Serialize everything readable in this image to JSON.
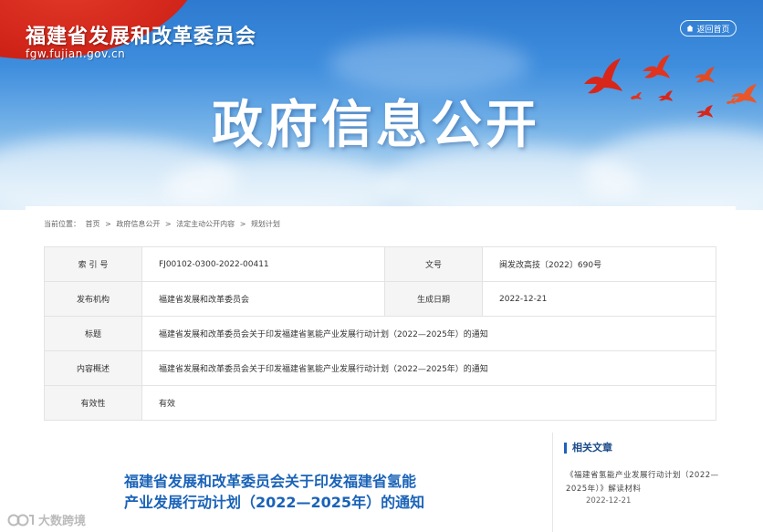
{
  "header": {
    "site_name": "福建省发展和改革委员会",
    "site_domain": "fgw.fujian.gov.cn",
    "return_home": "返回首页",
    "banner_title": "政府信息公开"
  },
  "breadcrumb": {
    "prefix": "当前位置：",
    "items": [
      "首页",
      "政府信息公开",
      "法定主动公开内容",
      "规划计划"
    ],
    "separator": ">"
  },
  "info_table": {
    "index_no_label": "索 引 号",
    "index_no_value": "FJ00102-0300-2022-00411",
    "doc_no_label": "文号",
    "doc_no_value": "闽发改高技〔2022〕690号",
    "publisher_label": "发布机构",
    "publisher_value": "福建省发展和改革委员会",
    "date_label": "生成日期",
    "date_value": "2022-12-21",
    "title_label": "标题",
    "title_value": "福建省发展和改革委员会关于印发福建省氢能产业发展行动计划（2022—2025年）的通知",
    "summary_label": "内容概述",
    "summary_value": "福建省发展和改革委员会关于印发福建省氢能产业发展行动计划（2022—2025年）的通知",
    "validity_label": "有效性",
    "validity_value": "有效"
  },
  "article": {
    "title_line1": "福建省发展和改革委员会关于印发福建省氢能",
    "title_line2": "产业发展行动计划（2022—2025年）的通知"
  },
  "related": {
    "heading": "相关文章",
    "items": [
      {
        "title": "《福建省氢能产业发展行动计划（2022—2025年）》解读材料",
        "date": "2022-12-21"
      }
    ]
  },
  "watermark": {
    "text": "大数跨境"
  },
  "colors": {
    "accent": "#1a63b8",
    "banner_red": "#cc1f14",
    "sky_blue": "#3f8ede"
  },
  "icons": {
    "return_home": "home-icon"
  }
}
